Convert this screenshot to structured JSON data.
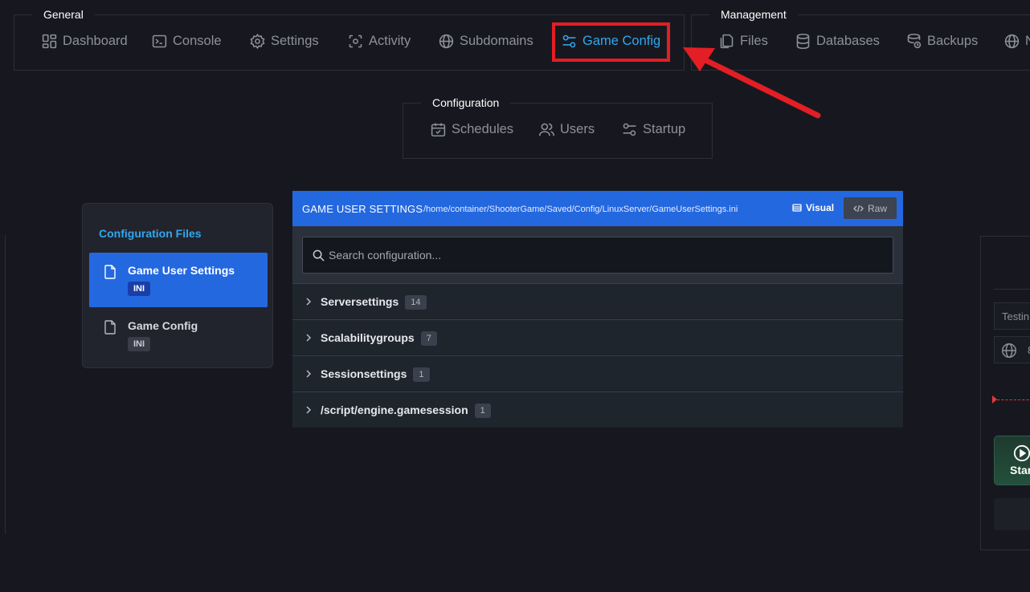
{
  "nav": {
    "general": {
      "label": "General",
      "items": [
        {
          "label": "Dashboard",
          "icon": "dashboard-icon"
        },
        {
          "label": "Console",
          "icon": "terminal-icon"
        },
        {
          "label": "Settings",
          "icon": "gear-icon"
        },
        {
          "label": "Activity",
          "icon": "activity-icon"
        },
        {
          "label": "Subdomains",
          "icon": "globe-icon"
        },
        {
          "label": "Game Config",
          "icon": "sliders-icon",
          "active": true
        }
      ]
    },
    "management": {
      "label": "Management",
      "items": [
        {
          "label": "Files",
          "icon": "files-icon"
        },
        {
          "label": "Databases",
          "icon": "database-icon"
        },
        {
          "label": "Backups",
          "icon": "backup-icon"
        },
        {
          "label": "N",
          "icon": "globe-icon"
        }
      ]
    },
    "configuration": {
      "label": "Configuration",
      "items": [
        {
          "label": "Schedules",
          "icon": "calendar-icon"
        },
        {
          "label": "Users",
          "icon": "users-icon"
        },
        {
          "label": "Startup",
          "icon": "sliders-icon"
        }
      ]
    }
  },
  "config_files": {
    "title": "Configuration Files",
    "files": [
      {
        "name": "Game User Settings",
        "badge": "INI",
        "selected": true
      },
      {
        "name": "Game Config",
        "badge": "INI",
        "selected": false
      }
    ]
  },
  "editor": {
    "title": "GAME USER SETTINGS",
    "path": "/home/container/ShooterGame/Saved/Config/LinuxServer/GameUserSettings.ini",
    "visual_label": "Visual",
    "raw_label": "Raw",
    "search_placeholder": "Search configuration...",
    "sections": [
      {
        "name": "Serversettings",
        "count": "14"
      },
      {
        "name": "Scalabilitygroups",
        "count": "7"
      },
      {
        "name": "Sessionsettings",
        "count": "1"
      },
      {
        "name": "/script/engine.gamesession",
        "count": "1"
      }
    ]
  },
  "right_panel": {
    "input_text": "Testin",
    "address_text": "8",
    "start_label": "Star"
  },
  "colors": {
    "background": "#17181f",
    "accent": "#2fa7ef",
    "primary_blue": "#2468e0",
    "annotation_red": "#e31e24"
  }
}
